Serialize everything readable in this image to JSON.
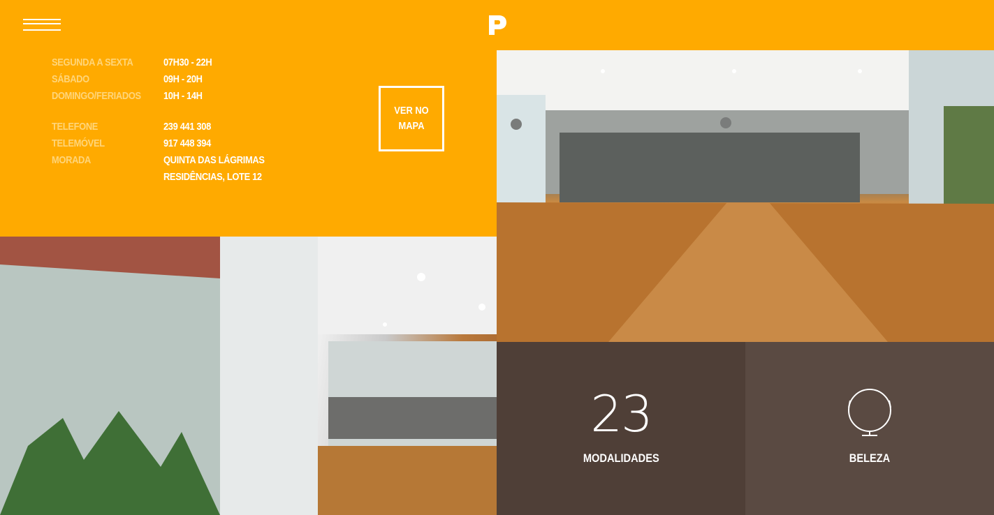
{
  "header": {
    "menu_icon": "hamburger-icon",
    "logo_icon": "p-logo-icon"
  },
  "hours": [
    {
      "label": "SEGUNDA A SEXTA",
      "value": "07H30 - 22H"
    },
    {
      "label": "SÁBADO",
      "value": "09H - 20H"
    },
    {
      "label": "DOMINGO/FERIADOS",
      "value": "10H - 14H"
    }
  ],
  "contacts": [
    {
      "label": "TELEFONE",
      "value": "239 441 308"
    },
    {
      "label": "TELEMÓVEL",
      "value": "917 448 394"
    },
    {
      "label": "MORADA",
      "value": "QUINTA DAS LÁGRIMAS"
    },
    {
      "label": "",
      "value": "RESIDÊNCIAS, LOTE 12"
    }
  ],
  "map_button": "VER NO MAPA",
  "tiles": {
    "modalidades": {
      "number": "23",
      "label": "MODALIDADES"
    },
    "beleza": {
      "icon": "mirror-icon",
      "label": "BELEZA"
    }
  },
  "colors": {
    "accent": "#ffaa00",
    "tile_dark": "#4f3f37",
    "tile_light": "#5a4a42"
  }
}
